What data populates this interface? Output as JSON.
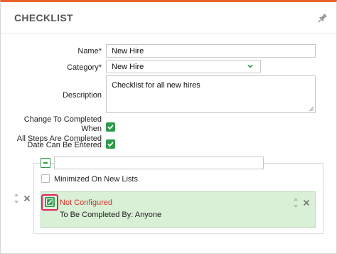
{
  "panel": {
    "title": "CHECKLIST",
    "accent": "#e8642c"
  },
  "form": {
    "name": {
      "label": "Name*",
      "value": "New Hire"
    },
    "category": {
      "label": "Category*",
      "value": "New Hire"
    },
    "description": {
      "label": "Description",
      "value": "Checklist for all new hires"
    },
    "change_to_completed": {
      "label_line1": "Change To Completed When",
      "label_line2": "All Steps Are Completed",
      "checked": true
    },
    "date_can_be_entered": {
      "label": "Date Can Be Entered",
      "checked": true
    }
  },
  "step": {
    "name_value": "",
    "minimized_label": "Minimized On New Lists",
    "minimized_checked": false
  },
  "task": {
    "status": "Not Configured",
    "assignment": "To Be Completed By: Anyone",
    "status_color": "#d9302c",
    "background": "#d9efd6"
  },
  "icons": {
    "pin": "pin-icon",
    "chevron": "chevron-down-icon",
    "edit": "edit-icon",
    "move": "reorder-arrows-icon",
    "remove": "close-icon"
  }
}
